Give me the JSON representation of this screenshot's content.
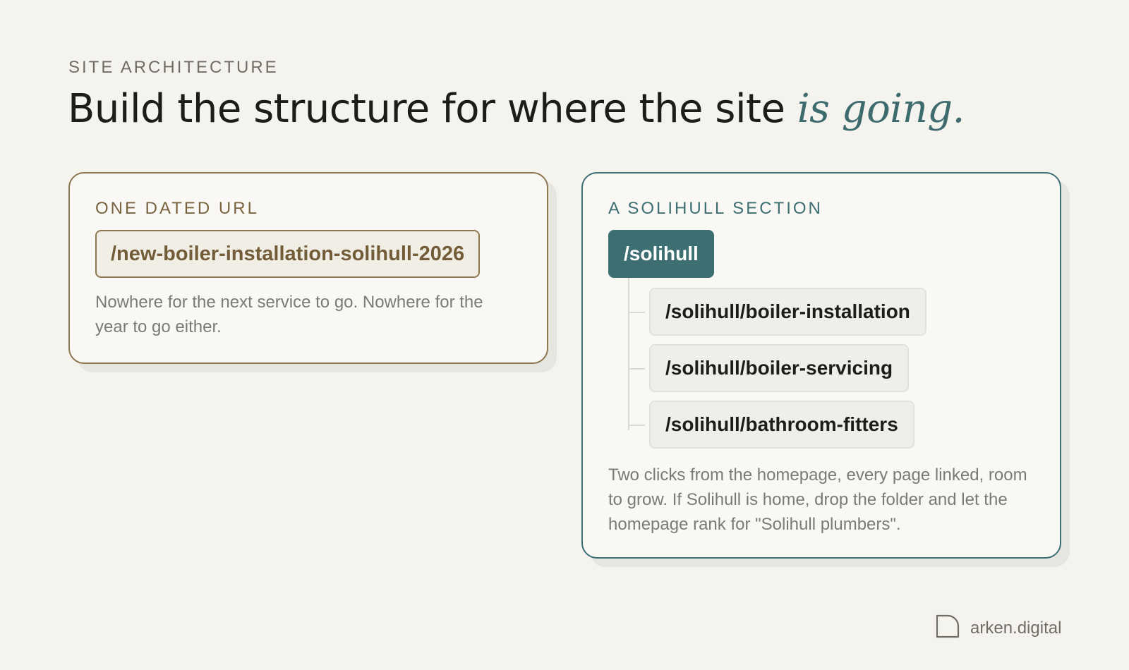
{
  "eyebrow": "SITE ARCHITECTURE",
  "headline": {
    "main": "Build the structure for where the site ",
    "accent": "is going."
  },
  "left_card": {
    "label": "ONE DATED URL",
    "url": "/new-boiler-installation-solihull-2026",
    "description": "Nowhere for the next service to go. Nowhere for the year to go either."
  },
  "right_card": {
    "label": "A SOLIHULL SECTION",
    "root": "/solihull",
    "children": [
      "/solihull/boiler-installation",
      "/solihull/boiler-servicing",
      "/solihull/bathroom-fitters"
    ],
    "description": "Two clicks from the homepage, every page linked, room to grow. If Solihull is home, drop the folder and let the homepage rank for \"Solihull plumbers\"."
  },
  "brand": {
    "name": "arken.digital",
    "icon": "arken-logo-icon"
  },
  "colors": {
    "background": "#f4f3ee",
    "teal_accent": "#3c6e72",
    "brown_accent": "#8c7650"
  }
}
